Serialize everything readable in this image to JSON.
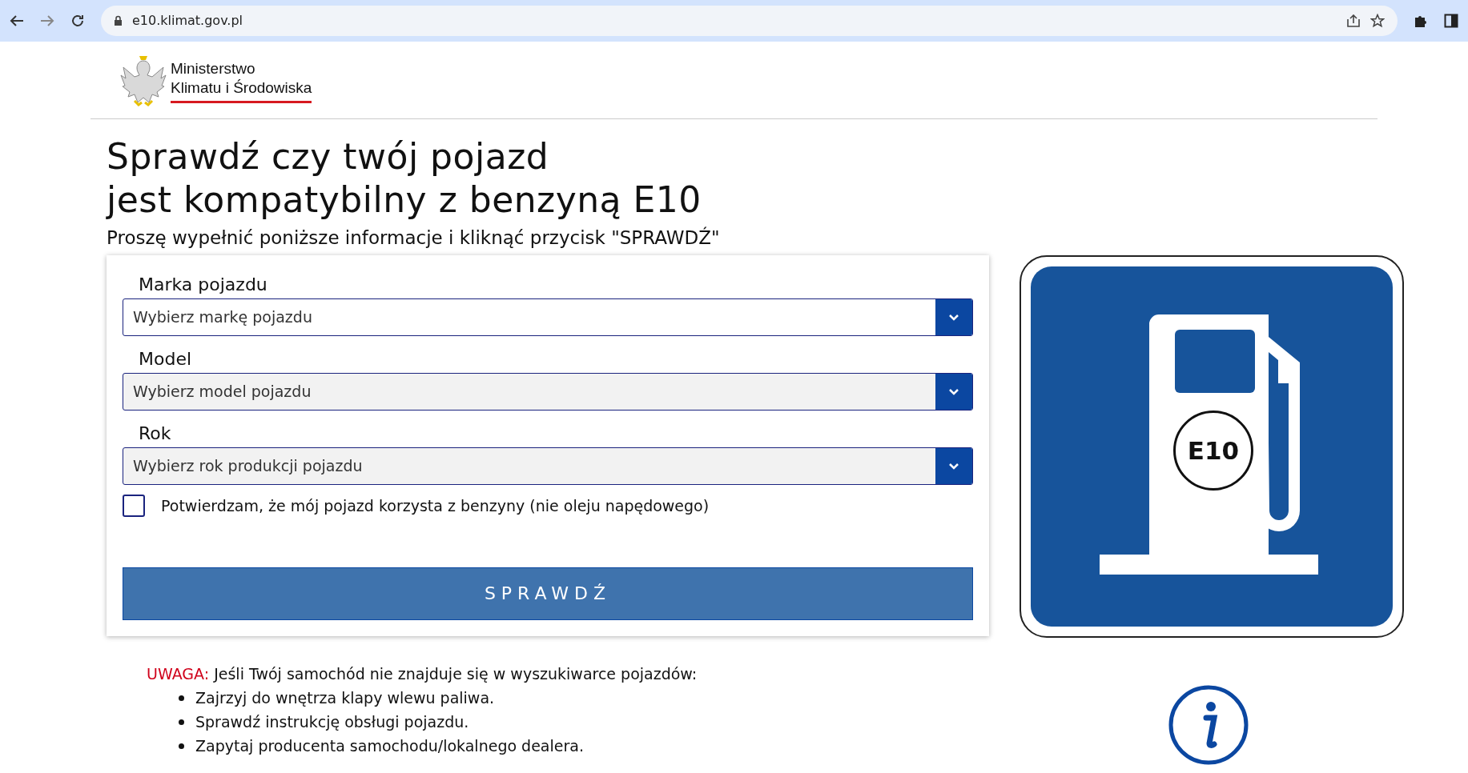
{
  "browser": {
    "url": "e10.klimat.gov.pl"
  },
  "header": {
    "ministry_name_lines": [
      "Ministerstwo",
      "Klimatu i Środowiska"
    ]
  },
  "page": {
    "title_lines": [
      "Sprawdź czy twój pojazd",
      "jest kompatybilny z benzyną E10"
    ],
    "subtitle": "Proszę wypełnić poniższe informacje i kliknąć przycisk \"SPRAWDŹ\""
  },
  "form": {
    "fields": [
      {
        "label": "Marka pojazdu",
        "placeholder": "Wybierz markę pojazdu",
        "disabled": false
      },
      {
        "label": "Model",
        "placeholder": "Wybierz model pojazdu",
        "disabled": true
      },
      {
        "label": "Rok",
        "placeholder": "Wybierz rok produkcji pojazdu",
        "disabled": true
      }
    ],
    "checkbox": {
      "label": "Potwierdzam, że mój pojazd korzysta z benzyny (nie oleju napędowego)",
      "checked": false
    },
    "submit_button": "SPRAWDŹ"
  },
  "sign": {
    "badge": "E10"
  },
  "notice": {
    "label": "UWAGA:",
    "text": "Jeśli Twój samochód nie znajduje się w wyszukiwarce pojazdów:",
    "items": [
      "Zajrzyj do wnętrza klapy wlewu paliwa.",
      "Sprawdź instrukcję obsługi pojazdu.",
      "Zapytaj producenta samochodu/lokalnego dealera."
    ]
  }
}
